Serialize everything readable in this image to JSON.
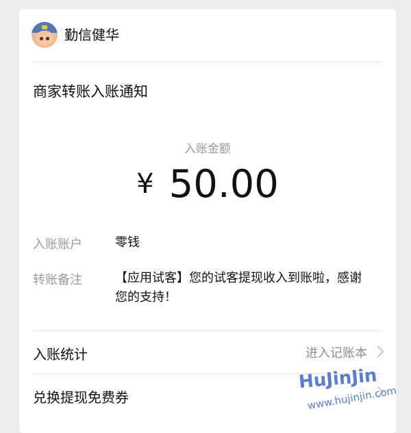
{
  "header": {
    "brand_name": "勤信健华",
    "avatar": "cartoon-avatar"
  },
  "notice": {
    "title": "商家转账入账通知",
    "amount_label": "入账金额",
    "currency_symbol": "¥",
    "amount": "50.00"
  },
  "details": [
    {
      "label": "入账账户",
      "value": "零钱"
    },
    {
      "label": "转账备注",
      "value": "【应用试客】您的试客提现收入到账啦，感谢您的支持！"
    }
  ],
  "links": [
    {
      "label": "入账统计",
      "right_text": "进入记账本",
      "icon": "chevron-right-icon"
    },
    {
      "label": "兑换提现免费券",
      "right_text": "",
      "icon": "chevron-right-icon"
    }
  ],
  "watermark": {
    "logo": "HuJinJin",
    "url": "www.hujinjin.com"
  }
}
